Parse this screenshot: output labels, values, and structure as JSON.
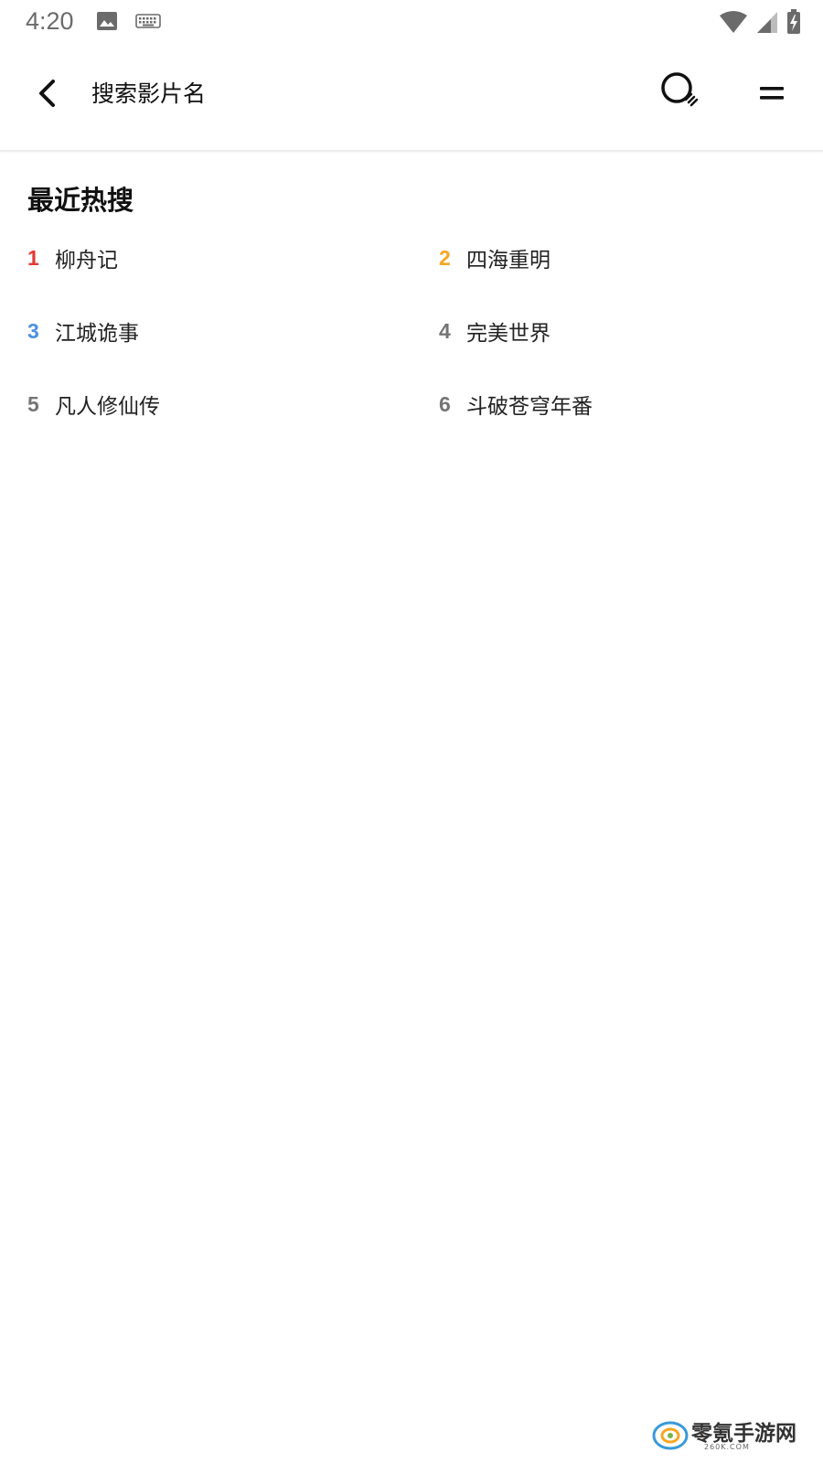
{
  "status_bar": {
    "time": "4:20",
    "icons": [
      "image-icon",
      "keyboard-icon",
      "wifi-icon",
      "signal-icon",
      "battery-charging-icon"
    ]
  },
  "app_bar": {
    "back_icon": "back-arrow-icon",
    "search_placeholder": "搜索影片名",
    "search_icon": "search-icon",
    "menu_icon": "menu-icon"
  },
  "hot_search": {
    "title": "最近热搜",
    "items": [
      {
        "rank": "1",
        "name": "柳舟记",
        "rank_color": "#e53935"
      },
      {
        "rank": "2",
        "name": "四海重明",
        "rank_color": "#f5a623"
      },
      {
        "rank": "3",
        "name": "江城诡事",
        "rank_color": "#4a90e2"
      },
      {
        "rank": "4",
        "name": "完美世界",
        "rank_color": "#757575"
      },
      {
        "rank": "5",
        "name": "凡人修仙传",
        "rank_color": "#757575"
      },
      {
        "rank": "6",
        "name": "斗破苍穹年番",
        "rank_color": "#757575"
      }
    ]
  },
  "watermark": {
    "text": "零氪手游网",
    "sub": "260K.COM"
  }
}
